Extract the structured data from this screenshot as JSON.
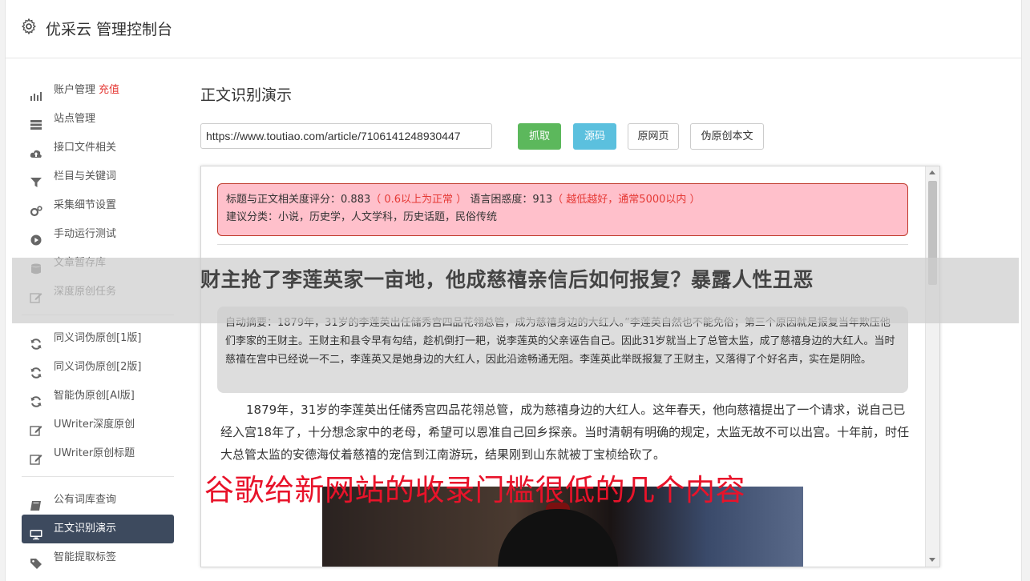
{
  "app": {
    "title": "优采云 管理控制台"
  },
  "sidebar": {
    "group1": [
      {
        "label": "账户管理",
        "badge": "充值",
        "icon": "bar-chart-icon"
      },
      {
        "label": "站点管理",
        "icon": "server-icon"
      },
      {
        "label": "接口文件相关",
        "icon": "cloud-upload-icon"
      },
      {
        "label": "栏目与关键词",
        "icon": "filter-icon"
      },
      {
        "label": "采集细节设置",
        "icon": "cogs-icon"
      },
      {
        "label": "手动运行测试",
        "icon": "play-circle-icon"
      },
      {
        "label": "文章暂存库",
        "icon": "database-icon"
      },
      {
        "label": "深度原创任务",
        "icon": "edit-icon"
      }
    ],
    "group2": [
      {
        "label": "同义词伪原创[1版]",
        "icon": "refresh-icon"
      },
      {
        "label": "同义词伪原创[2版]",
        "icon": "refresh-icon"
      },
      {
        "label": "智能伪原创[AI版]",
        "icon": "refresh-icon"
      },
      {
        "label": "UWriter深度原创",
        "icon": "edit-icon"
      },
      {
        "label": "UWriter原创标题",
        "icon": "edit-icon"
      }
    ],
    "group3": [
      {
        "label": "公有词库查询",
        "icon": "book-icon"
      },
      {
        "label": "正文识别演示",
        "icon": "monitor-icon",
        "active": true
      },
      {
        "label": "智能提取标签",
        "icon": "tag-icon"
      }
    ]
  },
  "main": {
    "title": "正文识别演示",
    "url_value": "https://www.toutiao.com/article/7106141248930447",
    "buttons": {
      "fetch": "抓取",
      "source": "源码",
      "original": "原网页",
      "rewrite": "伪原创本文"
    },
    "score": {
      "relevance_label": "标题与正文相关度评分：",
      "relevance_value": "0.883",
      "relevance_hint": "（ 0.6以上为正常 ）",
      "perplexity_label": "语言困惑度：",
      "perplexity_value": "913",
      "perplexity_hint": "（ 越低越好，通常5000以内 ）",
      "category_label": "建议分类：",
      "category_value": "小说，历史学，人文学科，历史话题，民俗传统"
    },
    "headline": "财主抢了李莲英家一亩地，他成慈禧亲信后如何报复？暴露人性丑恶",
    "summary": "自动摘要：1879年，31岁的李莲英出任储秀宫四品花翎总管，成为慈禧身边的大红人。”李莲英自然也不能免俗；第三个原因就是报复当年欺压他们李家的王财主。王财主和县令早有勾结，趁机倒打一耙，说李莲英的父亲诬告自己。因此31岁就当上了总管太监，成了慈禧身边的大红人。当时慈禧在宫中已经说一不二，李莲英又是她身边的大红人，因此沿途畅通无阻。李莲英此举既报复了王财主，又落得了个好名声，实在是阴险。",
    "paragraph": "1879年，31岁的李莲英出任储秀宫四品花翎总管，成为慈禧身边的大红人。这年春天，他向慈禧提出了一个请求，说自己已经入宫18年了，十分想念家中的老母，希望可以恩准自己回乡探亲。当时清朝有明确的规定，太监无故不可以出宫。十年前，时任大总管太监的安德海仗着慈禧的宠信到江南游玩，结果刚到山东就被丁宝桢给砍了。"
  },
  "watermark": "谷歌给新网站的收录门槛很低的几个内容"
}
